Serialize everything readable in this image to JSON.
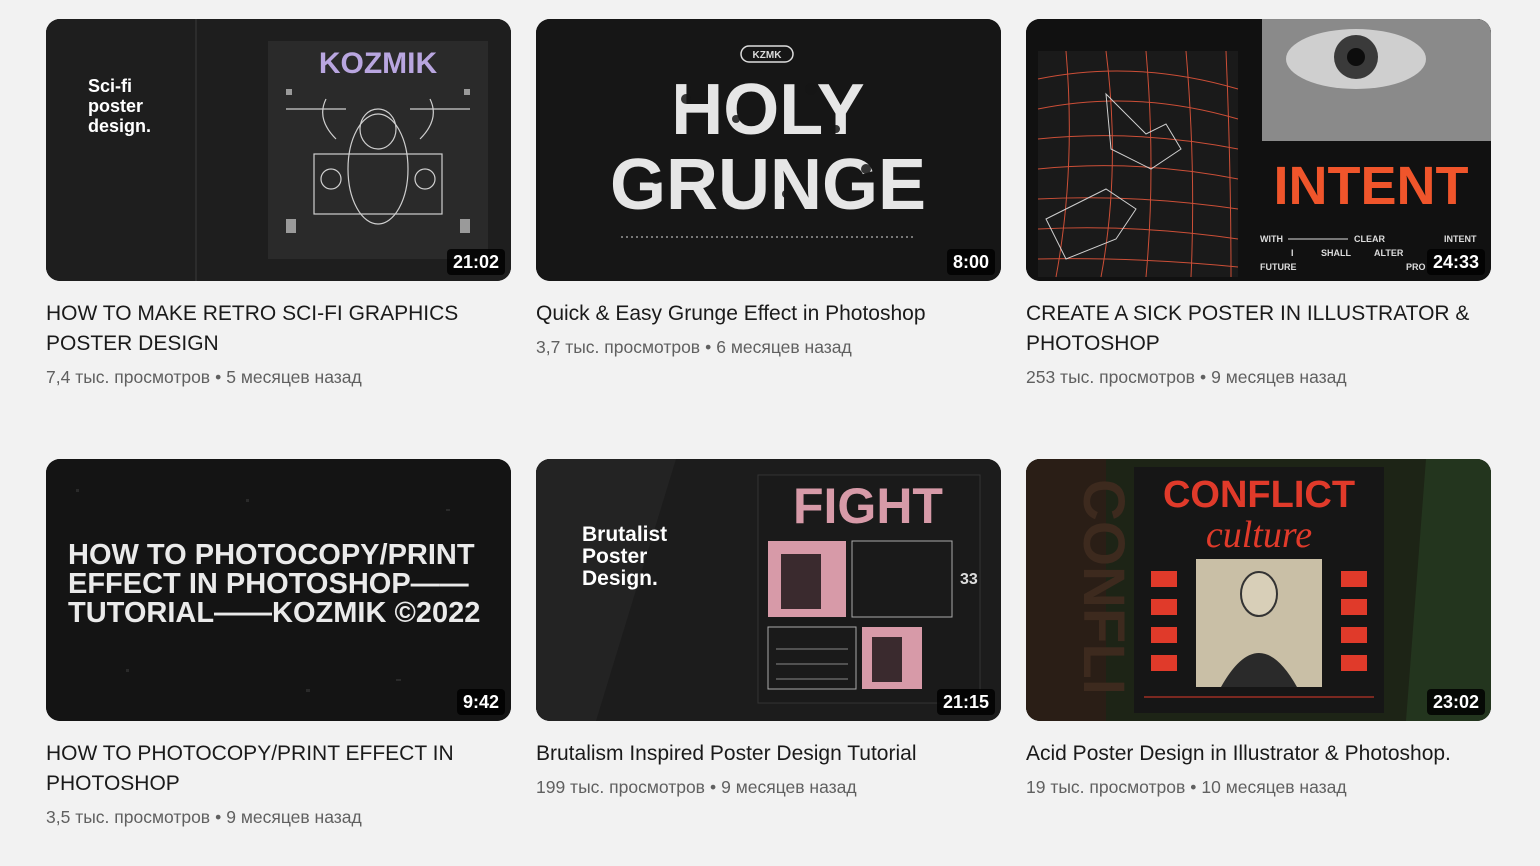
{
  "videos": [
    {
      "title": "HOW TO MAKE RETRO SCI-FI GRAPHICS POSTER DESIGN",
      "views": "7,4 тыс. просмотров",
      "age": "5 месяцев назад",
      "duration": "21:02",
      "thumb_text": {
        "caption": [
          "Sci-fi",
          "poster",
          "design."
        ],
        "logo": "KOZMIK"
      }
    },
    {
      "title": "Quick & Easy Grunge Effect in Photoshop",
      "views": "3,7 тыс. просмотров",
      "age": "6 месяцев назад",
      "duration": "8:00",
      "thumb_text": {
        "line1": "HOLY",
        "line2": "GRUNGE",
        "badge": "KZMK"
      }
    },
    {
      "title": "CREATE A SICK POSTER IN ILLUSTRATOR & PHOTOSHOP",
      "views": "253 тыс. просмотров",
      "age": "9 месяцев назад",
      "duration": "24:33",
      "thumb_text": {
        "headline": "INTENT",
        "words": [
          "WITH",
          "CLEAR",
          "INTENT",
          "I",
          "SHALL",
          "ALTER",
          "FUTURE",
          "PRO"
        ]
      }
    },
    {
      "title": "HOW TO PHOTOCOPY/PRINT EFFECT IN PHOTOSHOP",
      "views": "3,5 тыс. просмотров",
      "age": "9 месяцев назад",
      "duration": "9:42",
      "thumb_text": {
        "lines": [
          "HOW TO PHOTOCOPY/PRINT",
          "EFFECT IN PHOTOSHOP——",
          "TUTORIAL——KOZMIK ©2022"
        ]
      }
    },
    {
      "title": "Brutalism Inspired Poster Design Tutorial",
      "views": "199 тыс. просмотров",
      "age": "9 месяцев назад",
      "duration": "21:15",
      "thumb_text": {
        "caption": [
          "Brutalist",
          "Poster",
          "Design."
        ],
        "headline": "FIGHT",
        "number": "33"
      }
    },
    {
      "title": "Acid Poster Design in Illustrator & Photoshop.",
      "views": "19 тыс. просмотров",
      "age": "10 месяцев назад",
      "duration": "23:02",
      "thumb_text": {
        "line1": "CONFLICT",
        "line2": "culture",
        "side": "CONFLI"
      }
    }
  ],
  "colors": {
    "lavender": "#b9a6e0",
    "orange": "#f0552b",
    "pink": "#d79aa8",
    "red": "#e03a2a",
    "olive": "#2f3a22"
  },
  "dot": "•"
}
